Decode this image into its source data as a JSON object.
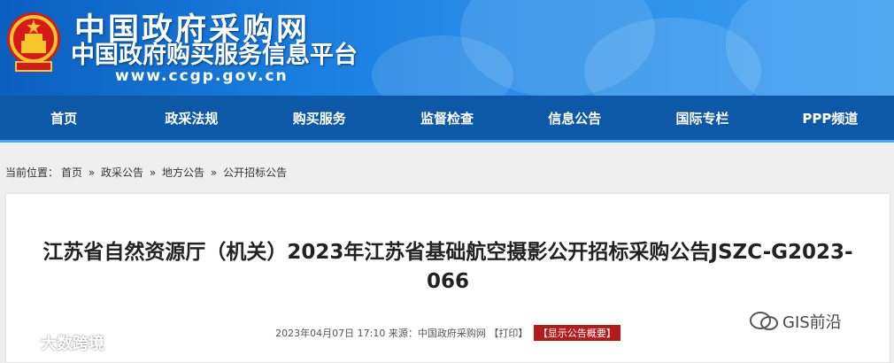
{
  "header": {
    "site_title": "中国政府采购网",
    "site_subtitle": "中国政府购买服务信息平台",
    "site_url": "www.ccgp.gov.cn",
    "logo_icon": "national-emblem-icon"
  },
  "nav": {
    "items": [
      {
        "label": "首页"
      },
      {
        "label": "政采法规"
      },
      {
        "label": "购买服务"
      },
      {
        "label": "监督检查"
      },
      {
        "label": "信息公告"
      },
      {
        "label": "国际专栏"
      },
      {
        "label": "PPP频道"
      }
    ]
  },
  "breadcrumb": {
    "prefix": "当前位置：",
    "items": [
      "首页",
      "政采公告",
      "地方公告",
      "公开招标公告"
    ],
    "separator": "»"
  },
  "article": {
    "title": "江苏省自然资源厅（机关）2023年江苏省基础航空摄影公开招标采购公告JSZC-G2023-066",
    "date": "2023年04月07日 17:10",
    "source_label": "来源：",
    "source": "中国政府采购网",
    "print_label": "【打印】",
    "summary_button": "【显示公告概要】"
  },
  "watermarks": {
    "left": "大数跨境",
    "right": "GIS前沿"
  },
  "colors": {
    "nav_bg": "#0e58a8",
    "banner": "#1a7fe0",
    "summary_button": "#b41c1c"
  }
}
